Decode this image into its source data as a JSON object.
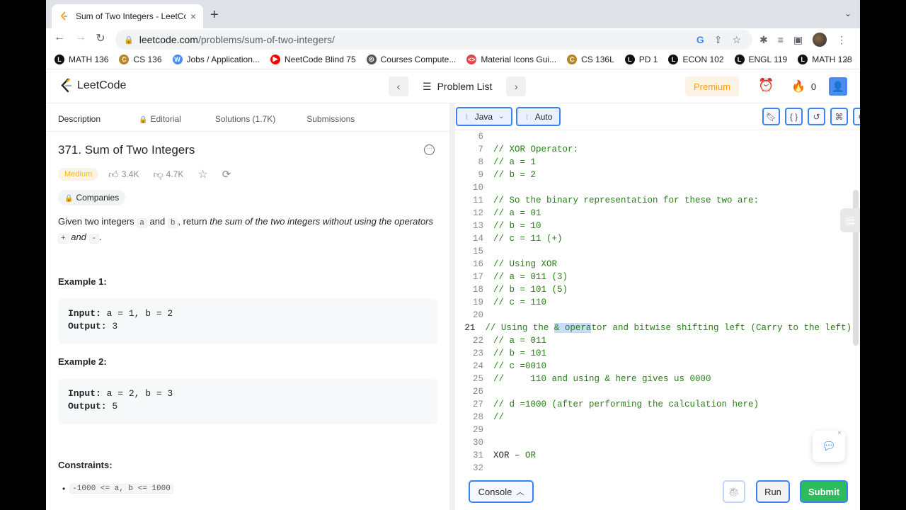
{
  "browser": {
    "tab_title": "Sum of Two Integers - LeetCod",
    "tab_close": "×",
    "new_tab": "+",
    "url_host": "leetcode.com",
    "url_path": "/problems/sum-of-two-integers/",
    "bookmarks": [
      {
        "label": "MATH 136",
        "color": "#111111",
        "glyph": "L"
      },
      {
        "label": "CS 136",
        "color": "#b8862b",
        "glyph": "C"
      },
      {
        "label": "Jobs / Application...",
        "color": "#4a8cf0",
        "glyph": "W"
      },
      {
        "label": "NeetCode Blind 75",
        "color": "#ff0000",
        "glyph": "▶"
      },
      {
        "label": "Courses Compute...",
        "color": "#555555",
        "glyph": "◎"
      },
      {
        "label": "Material Icons Gui...",
        "color": "#e04a4a",
        "glyph": "<>"
      },
      {
        "label": "CS 136L",
        "color": "#b8862b",
        "glyph": "C"
      },
      {
        "label": "PD 1",
        "color": "#111111",
        "glyph": "L"
      },
      {
        "label": "ECON 102",
        "color": "#111111",
        "glyph": "L"
      },
      {
        "label": "ENGL 119",
        "color": "#111111",
        "glyph": "L"
      },
      {
        "label": "MATH 128",
        "color": "#111111",
        "glyph": "L"
      }
    ],
    "bookmarks_more": "»"
  },
  "nav": {
    "logo_text": "LeetCode",
    "problem_list": "Problem List",
    "premium": "Premium",
    "streak": "0"
  },
  "left": {
    "tabs": {
      "description": "Description",
      "editorial": "Editorial",
      "solutions": "Solutions (1.7K)",
      "submissions": "Submissions"
    },
    "title": "371. Sum of Two Integers",
    "difficulty": "Medium",
    "likes": "3.4K",
    "dislikes": "4.7K",
    "companies": "Companies",
    "desc": {
      "p1": "Given two integers ",
      "a": "a",
      "p2": " and ",
      "b": "b",
      "p3": ", return ",
      "em": "the sum of the two integers without using the operators",
      "plus": "+",
      "and": " and ",
      "minus": "-",
      "end": "."
    },
    "example1": {
      "title": "Example 1:",
      "input_label": "Input:",
      "input": " a = 1, b = 2",
      "output_label": "Output:",
      "output": " 3"
    },
    "example2": {
      "title": "Example 2:",
      "input_label": "Input:",
      "input": " a = 2, b = 3",
      "output_label": "Output:",
      "output": " 5"
    },
    "constraints_title": "Constraints:",
    "constraint1": "-1000 <= a, b <= 1000"
  },
  "editor": {
    "language": "Java",
    "mode": "Auto",
    "lines": [
      {
        "n": "6",
        "t": ""
      },
      {
        "n": "7",
        "t": "// XOR Operator:"
      },
      {
        "n": "8",
        "t": "// a = 1"
      },
      {
        "n": "9",
        "t": "// b = 2"
      },
      {
        "n": "10",
        "t": ""
      },
      {
        "n": "11",
        "t": "// So the binary representation for these two are:"
      },
      {
        "n": "12",
        "t": "// a = 01"
      },
      {
        "n": "13",
        "t": "// b = 10"
      },
      {
        "n": "14",
        "t": "// c = 11 (+)"
      },
      {
        "n": "15",
        "t": ""
      },
      {
        "n": "16",
        "t": "// Using XOR"
      },
      {
        "n": "17",
        "t": "// a = 011 (3)"
      },
      {
        "n": "18",
        "t": "// b = 101 (5)"
      },
      {
        "n": "19",
        "t": "// c = 110"
      },
      {
        "n": "20",
        "t": ""
      },
      {
        "n": "21",
        "t": "",
        "pre": "// Using the ",
        "sel": "& opera",
        "post": "tor and bitwise shifting left (Carry to the left)"
      },
      {
        "n": "22",
        "t": "// a = 011"
      },
      {
        "n": "23",
        "t": "// b = 101"
      },
      {
        "n": "24",
        "t": "// c =0010"
      },
      {
        "n": "25",
        "t": "//     110 and using & here gives us 0000"
      },
      {
        "n": "26",
        "t": ""
      },
      {
        "n": "27",
        "t": "// d =1000 (after performing the calculation here)"
      },
      {
        "n": "28",
        "t": "//"
      },
      {
        "n": "29",
        "t": ""
      },
      {
        "n": "30",
        "t": ""
      },
      {
        "n": "31",
        "t": "",
        "kw": "XOR – ",
        "kw2": "OR"
      },
      {
        "n": "32",
        "t": ""
      }
    ],
    "console": "Console",
    "run": "Run",
    "submit": "Submit"
  }
}
